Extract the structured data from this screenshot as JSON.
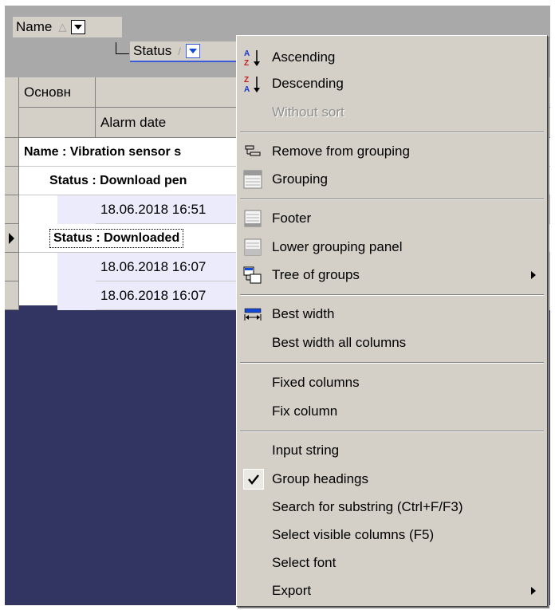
{
  "group_panel": {
    "chip1_label": "Name",
    "chip1_sort_glyph": "△",
    "chip2_label": "Status",
    "chip2_sort_glyph": "/"
  },
  "grid": {
    "header_col1": "Основн",
    "header_col2": "Alarm date",
    "rows": [
      {
        "text": "Name : Vibration sensor s"
      },
      {
        "text": "Status : Download pen"
      },
      {
        "text": "18.06.2018 16:51"
      },
      {
        "text": "Status : Downloaded"
      },
      {
        "text": "18.06.2018 16:07"
      },
      {
        "text": "18.06.2018 16:07"
      }
    ]
  },
  "menu": {
    "ascending": "Ascending",
    "descending": "Descending",
    "without_sort": "Without sort",
    "remove_from_grouping": "Remove from grouping",
    "grouping": "Grouping",
    "footer": "Footer",
    "lower_grouping_panel": "Lower grouping panel",
    "tree_of_groups": "Tree of groups",
    "best_width": "Best width",
    "best_width_all": "Best width all columns",
    "fixed_columns": "Fixed columns",
    "fix_column": "Fix column",
    "input_string": "Input string",
    "group_headings": "Group headings",
    "search_substring": "Search for substring (Ctrl+F/F3)",
    "select_visible_columns": "Select visible columns (F5)",
    "select_font": "Select font",
    "export": "Export"
  },
  "icons": {
    "sort_asc": "sort-ascending-icon",
    "sort_desc": "sort-descending-icon",
    "check": "checkmark-icon"
  },
  "colors": {
    "panel_bg": "#a9a9a9",
    "window_bg": "#323462",
    "menu_bg": "#d4d0c8",
    "row_highlight": "#ecebfb"
  }
}
